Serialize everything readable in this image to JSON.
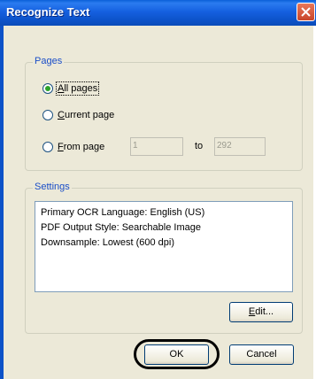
{
  "dialog": {
    "title": "Recognize Text"
  },
  "pages": {
    "group_label": "Pages",
    "options": {
      "all": {
        "access_key": "A",
        "rest": "ll pages",
        "selected": true
      },
      "current": {
        "access_key": "C",
        "rest": "urrent page",
        "selected": false
      },
      "from": {
        "access_key": "F",
        "rest": "rom page",
        "selected": false
      }
    },
    "from_value": "1",
    "to_label": "to",
    "to_value": "292"
  },
  "settings": {
    "group_label": "Settings",
    "lines": [
      "Primary OCR Language: English (US)",
      "PDF Output Style: Searchable Image",
      "Downsample: Lowest (600 dpi)"
    ],
    "edit_access_key": "E",
    "edit_rest": "dit..."
  },
  "buttons": {
    "ok": "OK",
    "cancel": "Cancel"
  }
}
